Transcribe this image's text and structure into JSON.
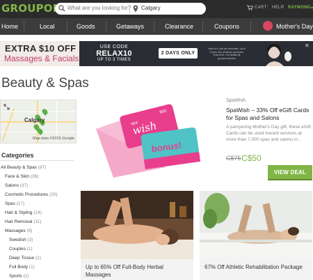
{
  "header": {
    "logo": "GROUPON",
    "search_placeholder": "What are you looking for?",
    "location": "Calgary",
    "cart": "CART",
    "help": "HELP",
    "user": "RAYMOND"
  },
  "nav": {
    "items": [
      "Home",
      "Local",
      "Goods",
      "Getaways",
      "Clearance",
      "Coupons",
      "Mother's Day"
    ]
  },
  "banner": {
    "line1": "EXTRA $10 OFF",
    "line2": "Massages & Facials",
    "code_label": "USE CODE",
    "code": "RELAX10",
    "code_limit": "UP TO 3 TIMES",
    "days": "2 DAYS ONLY",
    "fine_print": "Valid on 1 unit per purchase. Up to 3 uses. $11 minimum purchase. Ends 4/14. Full details @ groupon.ca/relax",
    "close": "✕"
  },
  "page": {
    "title": "Beauty & Spas"
  },
  "map": {
    "label": "Calgary",
    "credit": "Map data ©2015 Google"
  },
  "categories": {
    "heading": "Categories",
    "items": [
      {
        "label": "All Beauty & Spas",
        "count": "(97)"
      },
      {
        "label": "Face & Skin",
        "count": "(36)"
      },
      {
        "label": "Salons",
        "count": "(37)"
      },
      {
        "label": "Cosmetic Procedures",
        "count": "(20)"
      },
      {
        "label": "Spas",
        "count": "(17)"
      },
      {
        "label": "Hair & Styling",
        "count": "(14)"
      },
      {
        "label": "Hair Removal",
        "count": "(11)"
      },
      {
        "label": "Massages",
        "count": "(9)"
      },
      {
        "label": "Swedish",
        "count": "(3)"
      },
      {
        "label": "Couples",
        "count": "(1)"
      },
      {
        "label": "Deep Tissue",
        "count": "(1)"
      },
      {
        "label": "Full Body",
        "count": "(1)"
      },
      {
        "label": "Sports",
        "count": "(1)"
      }
    ]
  },
  "featured": {
    "merchant": "SpaWish",
    "title": "SpaWish – 33% Off eGift Cards for Spas and Salons",
    "description": "A pampering Mother's Day gift, these eGift Cards can be used toward services at more than 7,000 spas and salons in...",
    "price_old": "C$75",
    "price_new": "C$50",
    "cta": "VIEW DEAL",
    "card_text_1": "spa",
    "card_text_2": "wish",
    "card_bonus": "bonus!",
    "card_value": "$50"
  },
  "deals": [
    {
      "title": "Up to 65% Off Full-Body Herbal Massages"
    },
    {
      "title": "67% Off Athletic Rehabilitation Package"
    }
  ],
  "colors": {
    "brand": "#82b548",
    "topbar": "#2b2b2b",
    "nav": "#3c3c3c"
  }
}
